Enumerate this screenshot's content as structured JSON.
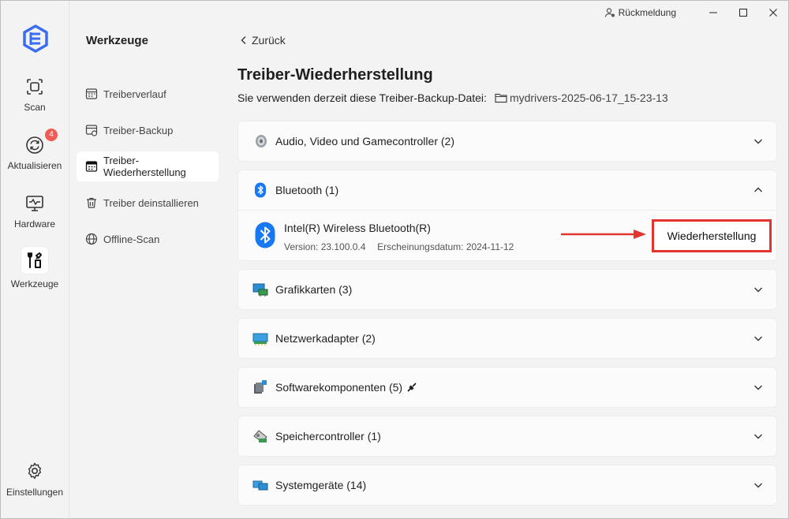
{
  "titlebar": {
    "feedback_label": "Rückmeldung"
  },
  "rail": {
    "items": [
      {
        "label": "Scan",
        "icon": "scan-icon"
      },
      {
        "label": "Aktualisieren",
        "icon": "refresh-icon",
        "badge": "4"
      },
      {
        "label": "Hardware",
        "icon": "hardware-icon"
      },
      {
        "label": "Werkzeuge",
        "icon": "tools-icon"
      }
    ],
    "settings_label": "Einstellungen"
  },
  "subnav": {
    "title": "Werkzeuge",
    "items": [
      {
        "label": "Treiberverlauf",
        "icon": "history-icon"
      },
      {
        "label": "Treiber-Backup",
        "icon": "backup-icon"
      },
      {
        "label": "Treiber-Wiederherstellung",
        "icon": "restore-icon",
        "active": true
      },
      {
        "label": "Treiber deinstallieren",
        "icon": "trash-icon"
      },
      {
        "label": "Offline-Scan",
        "icon": "globe-icon"
      }
    ]
  },
  "main": {
    "back_label": "Zurück",
    "title": "Treiber-Wiederherstellung",
    "backup_prefix": "Sie verwenden derzeit diese Treiber-Backup-Datei:",
    "backup_file": "mydrivers-2025-06-17_15-23-13",
    "categories": [
      {
        "label": "Audio, Video und Gamecontroller (2)",
        "icon": "speaker-icon",
        "expanded": false
      },
      {
        "label": "Bluetooth (1)",
        "icon": "bluetooth-icon",
        "expanded": true
      },
      {
        "label": "Grafikkarten (3)",
        "icon": "monitor-icon",
        "expanded": false
      },
      {
        "label": "Netzwerkadapter (2)",
        "icon": "network-icon",
        "expanded": false
      },
      {
        "label": "Softwarekomponenten (5)",
        "icon": "software-icon",
        "expanded": false
      },
      {
        "label": "Speichercontroller (1)",
        "icon": "storage-icon",
        "expanded": false
      },
      {
        "label": "Systemgeräte (14)",
        "icon": "system-icon",
        "expanded": false
      }
    ],
    "device": {
      "name": "Intel(R) Wireless Bluetooth(R)",
      "version": "Version: 23.100.0.4",
      "date": "Erscheinungsdatum: 2024-11-12",
      "action_label": "Wiederherstellung"
    }
  },
  "colors": {
    "accent": "#1877f2",
    "highlight": "#e3342f",
    "badge": "#f05c55"
  }
}
